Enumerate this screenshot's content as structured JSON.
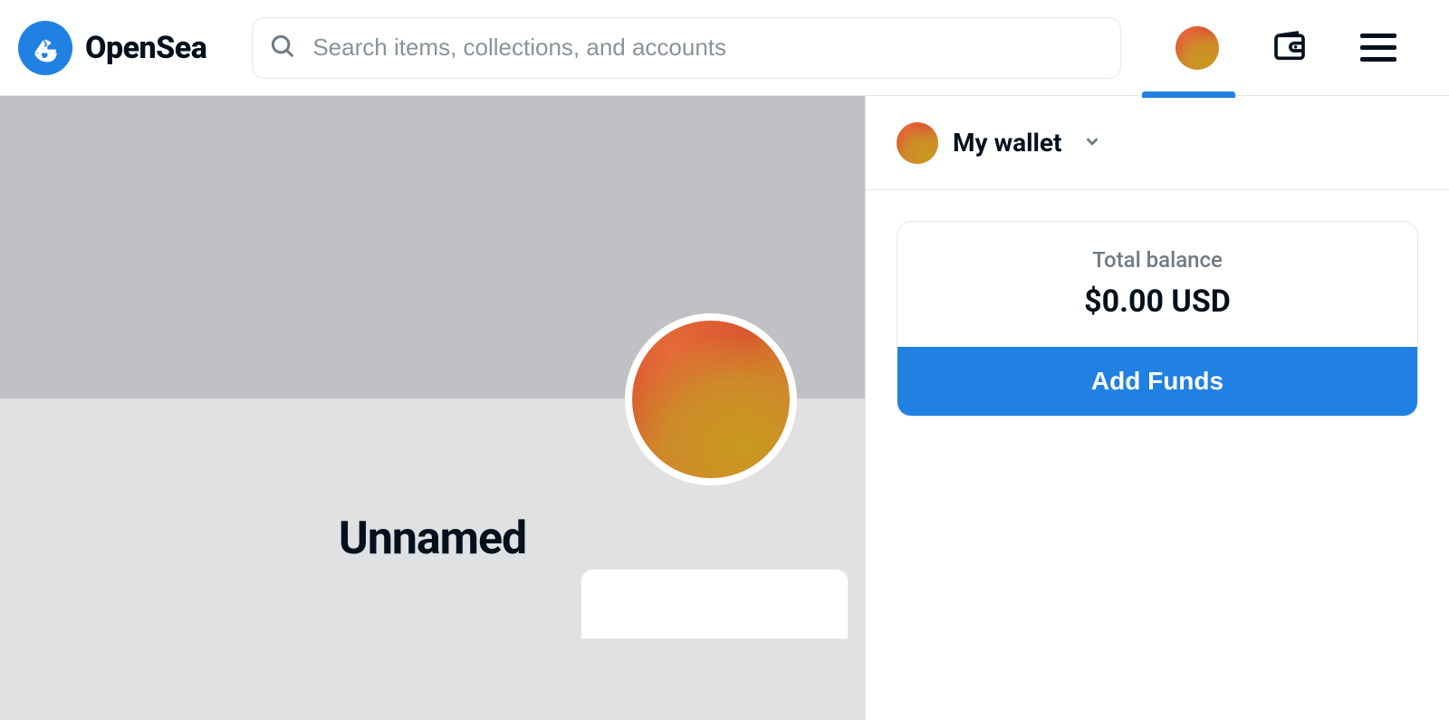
{
  "brand": {
    "name": "OpenSea"
  },
  "search": {
    "placeholder": "Search items, collections, and accounts"
  },
  "profile": {
    "display_name": "Unnamed"
  },
  "wallet": {
    "panel_title": "My wallet",
    "balance_label": "Total balance",
    "balance_value": "$0.00 USD",
    "add_funds_label": "Add Funds"
  },
  "colors": {
    "brand_blue": "#2081e2",
    "text_primary": "#04111d",
    "text_muted": "#707a83"
  }
}
